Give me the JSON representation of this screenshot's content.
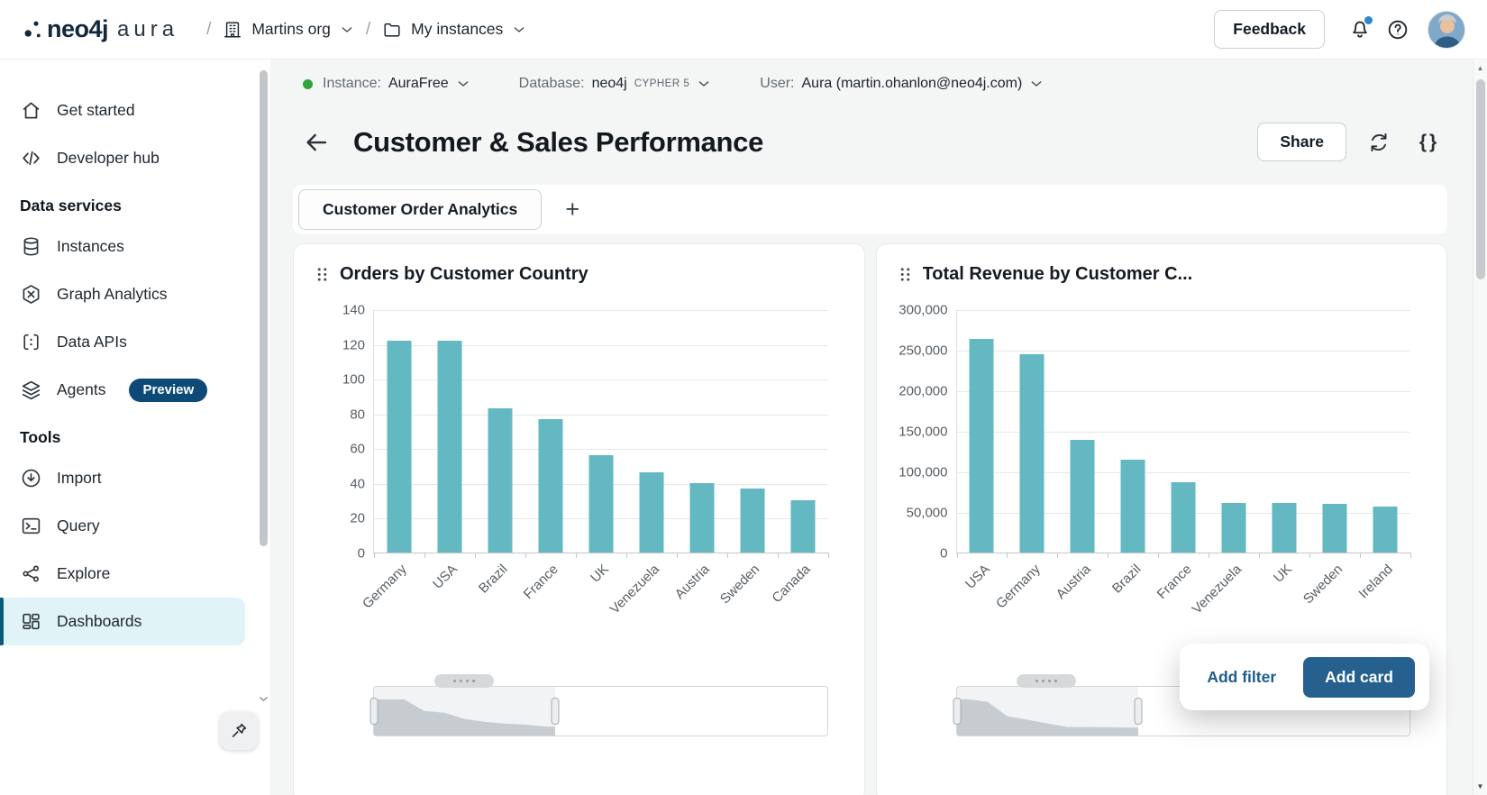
{
  "topbar": {
    "logo_neo4j": "neo4j",
    "logo_aura": "aura",
    "separator": "/",
    "org": "Martins org",
    "project": "My instances",
    "feedback": "Feedback"
  },
  "context_bar": {
    "instance_label": "Instance:",
    "instance_value": "AuraFree",
    "database_label": "Database:",
    "database_value": "neo4j",
    "cypher_badge": "CYPHER 5",
    "user_label": "User:",
    "user_value": "Aura (martin.ohanlon@neo4j.com)"
  },
  "sidebar": {
    "primary": [
      {
        "label": "Get started"
      },
      {
        "label": "Developer hub"
      }
    ],
    "data_services_header": "Data services",
    "data_services": [
      {
        "label": "Instances"
      },
      {
        "label": "Graph Analytics"
      },
      {
        "label": "Data APIs"
      },
      {
        "label": "Agents",
        "badge": "Preview"
      }
    ],
    "tools_header": "Tools",
    "tools": [
      {
        "label": "Import"
      },
      {
        "label": "Query"
      },
      {
        "label": "Explore"
      },
      {
        "label": "Dashboards"
      }
    ]
  },
  "page": {
    "title": "Customer & Sales Performance",
    "share_button": "Share",
    "tab_label": "Customer Order Analytics",
    "add_tab_icon": "+"
  },
  "popup": {
    "add_filter": "Add filter",
    "add_card": "Add card"
  },
  "icons": {
    "braces": "{}",
    "arrow_up": "▲",
    "arrow_down": "▼"
  },
  "colors": {
    "bar_teal": "#63b8c2",
    "accent_blue": "#25608f",
    "badge_navy": "#0d4a77",
    "instance_green": "#2ea43a",
    "active_item_bg": "#e0f3f6"
  },
  "chart_data": [
    {
      "type": "bar",
      "title": "Orders by Customer Country",
      "categories": [
        "Germany",
        "USA",
        "Brazil",
        "France",
        "UK",
        "Venezuela",
        "Austria",
        "Sweden",
        "Canada"
      ],
      "values": [
        122,
        122,
        83,
        77,
        56,
        46,
        40,
        37,
        30
      ],
      "xlabel": "",
      "ylabel": "",
      "ylim": [
        0,
        140
      ],
      "yticks": [
        0,
        20,
        40,
        60,
        80,
        100,
        120,
        140
      ],
      "grid": true,
      "legend": false,
      "bar_color": "#63b8c2",
      "slider_window_pct": [
        0,
        40
      ]
    },
    {
      "type": "bar",
      "title": "Total Revenue by Customer C...",
      "categories": [
        "USA",
        "Germany",
        "Austria",
        "Brazil",
        "France",
        "Venezuela",
        "UK",
        "Sweden",
        "Ireland"
      ],
      "values": [
        263000,
        245000,
        139000,
        115000,
        87000,
        61000,
        61000,
        60000,
        57000
      ],
      "xlabel": "",
      "ylabel": "",
      "ylim": [
        0,
        300000
      ],
      "yticks": [
        0,
        50000,
        100000,
        150000,
        200000,
        250000,
        300000
      ],
      "grid": true,
      "legend": false,
      "bar_color": "#63b8c2",
      "slider_window_pct": [
        0,
        40
      ]
    }
  ]
}
